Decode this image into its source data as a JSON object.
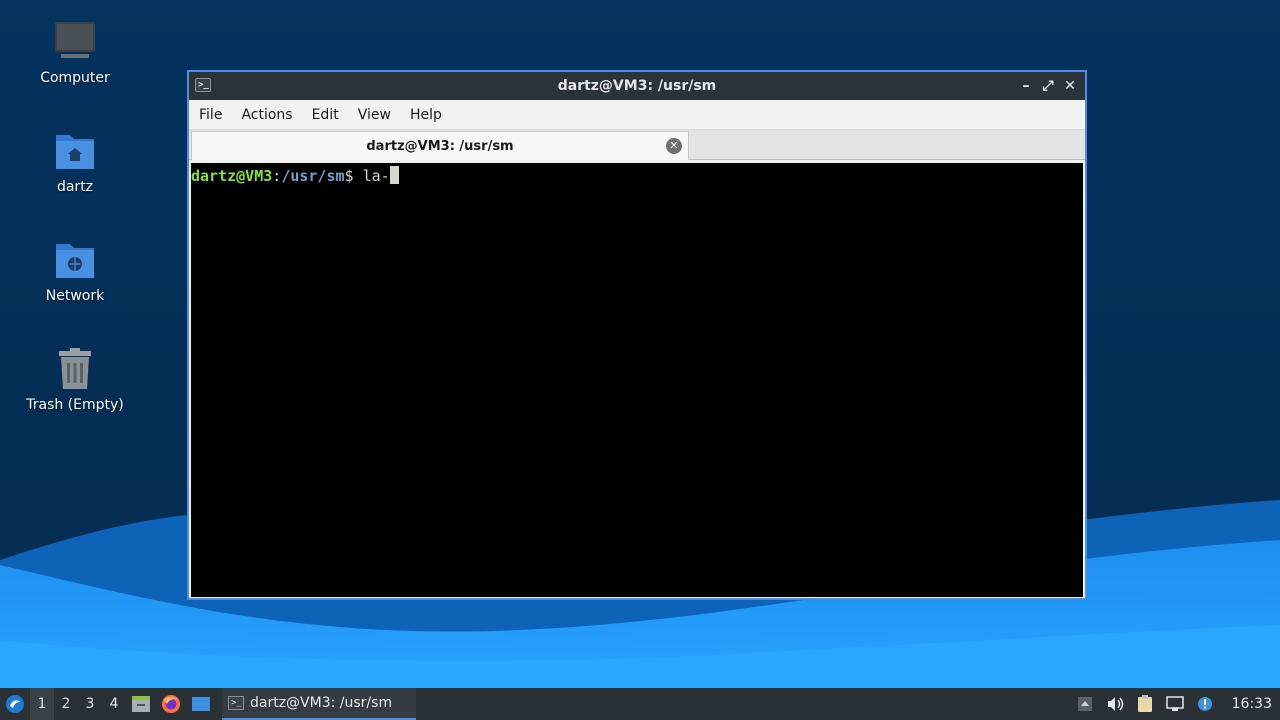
{
  "desktop": {
    "icons": [
      {
        "label": "Computer",
        "icon": "computer-icon"
      },
      {
        "label": "dartz",
        "icon": "home-folder-icon"
      },
      {
        "label": "Network",
        "icon": "network-folder-icon"
      },
      {
        "label": "Trash (Empty)",
        "icon": "trash-icon"
      }
    ]
  },
  "window": {
    "title": "dartz@VM3: /usr/sm",
    "menu": [
      "File",
      "Actions",
      "Edit",
      "View",
      "Help"
    ],
    "tab_label": "dartz@VM3: /usr/sm",
    "terminal": {
      "user_host": "dartz@VM3",
      "separator": ":",
      "path": "/usr/sm",
      "dollar": "$",
      "command": " la-"
    }
  },
  "taskbar": {
    "workspaces": [
      "1",
      "2",
      "3",
      "4"
    ],
    "active_workspace": "1",
    "task_label": "dartz@VM3: /usr/sm",
    "clock": "16:33"
  },
  "colors": {
    "accent": "#4c8ee8",
    "prompt_user": "#8ae234",
    "prompt_path": "#729fcf",
    "desktop_bg": "#05305a"
  }
}
